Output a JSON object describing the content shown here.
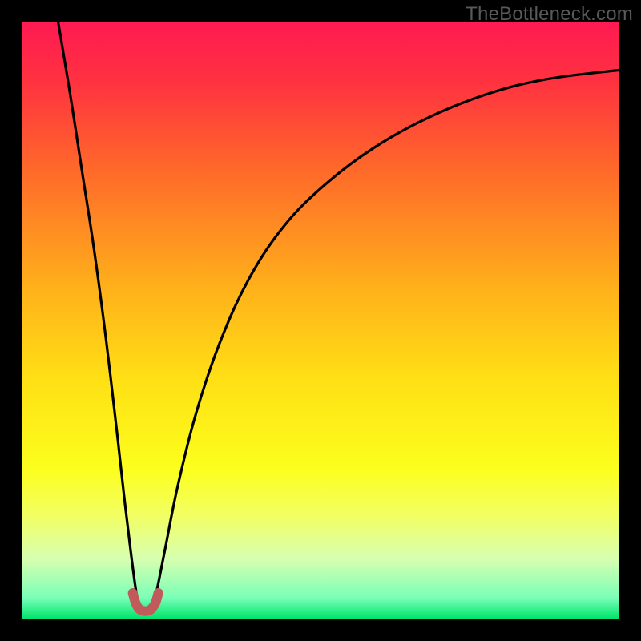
{
  "watermark": "TheBottleneck.com",
  "chart_data": {
    "type": "line",
    "title": "",
    "xlabel": "",
    "ylabel": "",
    "xlim": [
      0,
      100
    ],
    "ylim": [
      0,
      100
    ],
    "grid": false,
    "legend": false,
    "background_gradient_stops": [
      {
        "pos": 0.0,
        "color": "#ff1a52"
      },
      {
        "pos": 0.1,
        "color": "#ff3240"
      },
      {
        "pos": 0.25,
        "color": "#ff6a2a"
      },
      {
        "pos": 0.45,
        "color": "#ffb21a"
      },
      {
        "pos": 0.6,
        "color": "#ffe015"
      },
      {
        "pos": 0.75,
        "color": "#fcff1d"
      },
      {
        "pos": 0.83,
        "color": "#f1ff66"
      },
      {
        "pos": 0.9,
        "color": "#d7ffb0"
      },
      {
        "pos": 0.965,
        "color": "#7affb8"
      },
      {
        "pos": 1.0,
        "color": "#00e46a"
      }
    ],
    "series": [
      {
        "name": "left-descent",
        "note": "Steep left branch approaching the minimum from the top-left",
        "x": [
          6,
          8,
          10,
          12,
          14,
          16,
          17,
          18.2,
          19.0,
          19.6
        ],
        "y": [
          100,
          88,
          75,
          62,
          47,
          30,
          21,
          11,
          5,
          1.8
        ]
      },
      {
        "name": "valley-marker",
        "note": "Small U-shaped marker at the bottom of the dip",
        "stroke": "#c15a5a",
        "stroke_width": 12,
        "x": [
          18.5,
          19.0,
          19.6,
          20.3,
          21.0,
          21.6,
          22.3,
          22.8
        ],
        "y": [
          4.3,
          2.6,
          1.6,
          1.3,
          1.3,
          1.6,
          2.6,
          4.3
        ]
      },
      {
        "name": "right-ascent",
        "note": "Right branch rising from the minimum and curving toward the top-right",
        "x": [
          21.8,
          22.6,
          24,
          26,
          29,
          33,
          38,
          44,
          51,
          59,
          68,
          78,
          88,
          100
        ],
        "y": [
          1.8,
          5,
          12,
          22,
          34,
          46,
          57,
          66,
          73,
          79,
          84,
          88,
          90.5,
          92
        ]
      }
    ],
    "valley_x": 20.5,
    "valley_y": 1.3
  }
}
